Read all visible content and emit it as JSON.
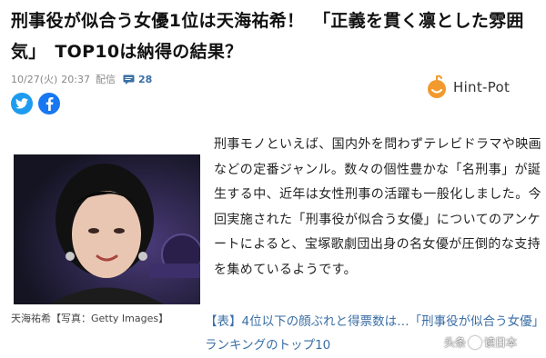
{
  "article": {
    "headline": "刑事役が似合う女優1位は天海祐希！　「正義を貫く凛とした雰囲気」　TOP10は納得の結果？",
    "date": "10/27(火)",
    "time": "20:37",
    "delivered": "配信",
    "comment_count": "28",
    "body": "刑事モノといえば、国内外を問わずテレビドラマや映画などの定番ジャンル。数々の個性豊かな「名刑事」が誕生する中、近年は女性刑事の活躍も一般化しました。今回実施された「刑事役が似合う女優」についてのアンケートによると、宝塚歌劇団出身の名女優が圧倒的な支持を集めているようです。",
    "photo_caption": "天海祐希【写真：Getty Images】",
    "related_link": "【表】4位以下の顔ぶれと得票数は…「刑事役が似合う女優」ランキングのトップ10"
  },
  "brand": {
    "name": "Hint-Pot"
  },
  "share": {
    "icons": [
      "twitter-icon",
      "facebook-icon"
    ]
  },
  "watermark": {
    "text_left": "头条",
    "text_right": "读日本"
  },
  "colors": {
    "link": "#3a6ea5",
    "twitter": "#1d9bf0",
    "facebook": "#1877f2",
    "brand_orange": "#f29a2e"
  }
}
